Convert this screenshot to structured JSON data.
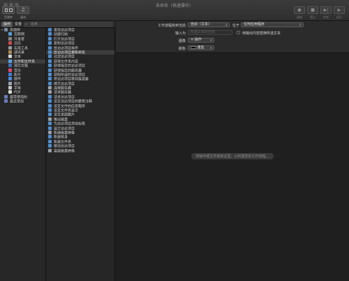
{
  "window": {
    "title": "未命名（快速操作）"
  },
  "toolbar": {
    "left": [
      {
        "label": "资源库",
        "icon": "library-icon"
      },
      {
        "label": "媒体",
        "icon": "media-icon"
      }
    ],
    "right": [
      {
        "label": "录制",
        "icon": "record-icon"
      },
      {
        "label": "停止",
        "icon": "stop-icon"
      },
      {
        "label": "步进",
        "icon": "step-icon"
      },
      {
        "label": "运行",
        "icon": "run-icon"
      }
    ]
  },
  "library": {
    "tabs": [
      "操作",
      "变量"
    ],
    "search_placeholder": "名称",
    "categories": [
      {
        "label": "资源库",
        "color": "#7a8fa8",
        "child": false
      },
      {
        "label": "互联网",
        "color": "#5a9bd5",
        "child": true
      },
      {
        "label": "开发者",
        "color": "#888888",
        "child": true
      },
      {
        "label": "日历",
        "color": "#d04a4a",
        "child": true
      },
      {
        "label": "实用工具",
        "color": "#9a9a9a",
        "child": true
      },
      {
        "label": "通讯录",
        "color": "#b08a5a",
        "child": true
      },
      {
        "label": "文本",
        "color": "#d8d8d8",
        "child": true
      },
      {
        "label": "文件和文件夹",
        "color": "#5fa0e0",
        "child": true,
        "selected": true
      },
      {
        "label": "演示文稿",
        "color": "#3d6fb5",
        "child": true
      },
      {
        "label": "音乐",
        "color": "#e04a6a",
        "child": true
      },
      {
        "label": "影片",
        "color": "#3f7fd0",
        "child": true
      },
      {
        "label": "邮件",
        "color": "#4a8fd8",
        "child": true
      },
      {
        "label": "照片",
        "color": "#9aa8b8",
        "child": true
      },
      {
        "label": "字体",
        "color": "#c8c8c8",
        "child": true
      },
      {
        "label": "PDF",
        "color": "#d8d8d8",
        "child": true
      },
      {
        "label": "最常使用的",
        "color": "#6c7fc0",
        "child": false
      },
      {
        "label": "最近添加",
        "color": "#6c7fc0",
        "child": false
      }
    ],
    "actions": [
      "查找访达项目",
      "创建归档",
      "打开访达项目",
      "复制访达项目",
      "给访达项目排序",
      "给访达项目重新命名",
      "过滤访达项目",
      "获得文件夹内容",
      "获得指定的访达项目",
      "获得指定的服务器",
      "获取所选的访达项目",
      "将访达项目移到废纸篓",
      "拷贝访达项目",
      "连接服务器",
      "请求服务器",
      "请求访达项目",
      "设定访达项目的聚焦注释",
      "设定文件的应用程序",
      "设定文件夹显示",
      "设定桌面图片",
      "推出磁盘",
      "为访达项目添加标签",
      "显示访达项目",
      "新建磁盘映像",
      "新建替身",
      "新建文件夹",
      "移动访达项目",
      "装载磁盘映像"
    ],
    "selected_action_index": 5
  },
  "config": {
    "receives_label": "工作流程收到当前",
    "receives_value": "自动（文本）",
    "in_label": "位于",
    "in_value": "任何应用程序",
    "input_label": "输入为",
    "input_placeholder": "所选文本的内容",
    "replace_label": "用输出内容替换所选文本",
    "image_label": "图像",
    "image_value": "操作",
    "color_label": "颜色",
    "color_value": "黑色"
  },
  "canvas": {
    "hint": "将操作或文件拖到这里，以构建您的工作流程。"
  }
}
